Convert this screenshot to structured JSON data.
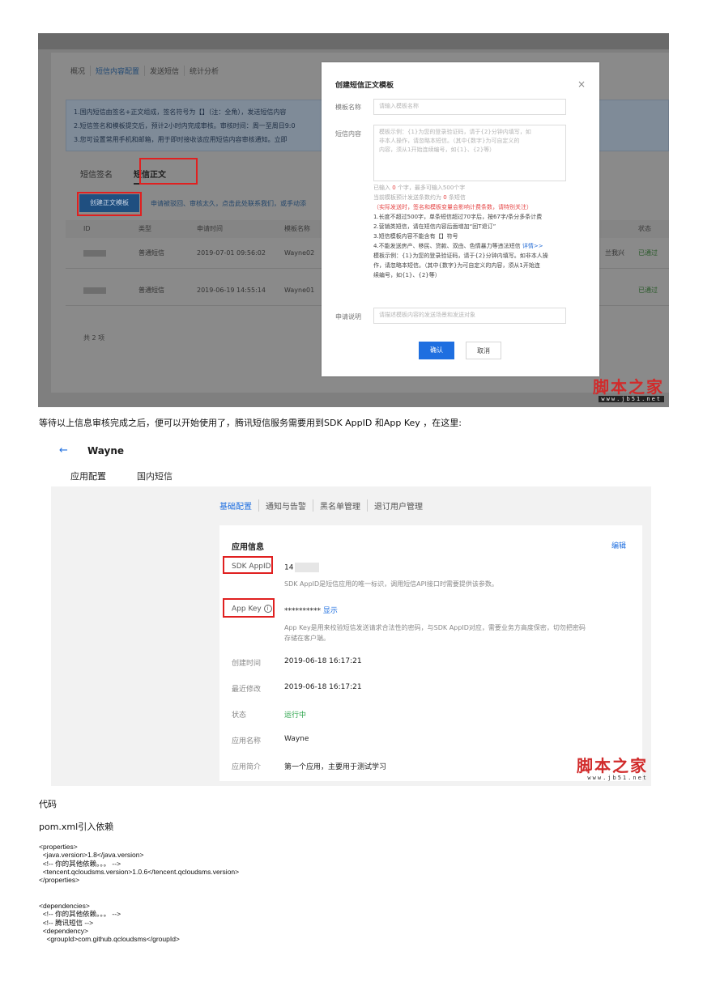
{
  "shot1": {
    "tabs": [
      "概况",
      "短信内容配置",
      "发送短信",
      "统计分析"
    ],
    "notice": [
      "1.国内短信由签名+正文组成，签名符号为【】（注：全角），发送短信内容",
      "2.短信签名和模板提交后，预计2小时内完成审核。审核时间：周一至周日9:0",
      "3.您可设置常用手机和邮箱，用于即时接收该应用短信内容审核通知。立即"
    ],
    "subtabs": [
      "短信签名",
      "短信正文"
    ],
    "create_button": "创建正文模板",
    "link_text": "申请被驳回、审核太久，点击此处联系我们，或手动添",
    "table_headers": [
      "ID",
      "类型",
      "申请时间",
      "模板名称",
      "状态"
    ],
    "rows": [
      {
        "type": "普通短信",
        "time": "2019-07-01 09:56:02",
        "name": "Wayne02",
        "extra": "兰我兴",
        "status": "已通过"
      },
      {
        "type": "普通短信",
        "time": "2019-06-19 14:55:14",
        "name": "Wayne01",
        "extra": "",
        "status": "已通过"
      }
    ],
    "total": "共 2 项"
  },
  "modal": {
    "title": "创建短信正文模板",
    "close": "×",
    "name_label": "模板名称",
    "name_placeholder": "请输入模板名称",
    "content_label": "短信内容",
    "content_placeholder": [
      "模板示例：{1}为您的登录验证码，请于{2}分钟内填写，如",
      "非本人操作，请忽略本短信。（其中{数字}为可自定义的",
      "内容，须从1开始连续编号，如{1}、{2}等）"
    ],
    "counter_prefix": "已输入",
    "counter_count": "0",
    "counter_suffix": "个字，最多可输入500个字",
    "estimate_prefix": "当前模板预计发送条数约为",
    "estimate_count": "0",
    "estimate_suffix": "条短信",
    "red_note": "（实际发送时，签名和模板变量会影响计费条数，请特别关注）",
    "rule1": "1.长度不超过500字，单条短信超过70字后，按67字/条分多条计费",
    "rule2": "2.营销类短信，请在短信内容后面增加“回T退订”",
    "rule3": "3.短信模板内容不能含有【】符号",
    "rule4": "4.不能发送房产、移民、贷款、双由、色情暴力等违法短信",
    "rule4_link": "详情>>",
    "example1": "模板示例：{1}为您的登录验证码，请于{2}分钟内填写。如非本人操",
    "example2": "作，请忽略本短信。（其中{数字}为可自定义的内容，须从1开始连",
    "example3": "续编号，如{1}、{2}等）",
    "reason_label": "申请说明",
    "reason_placeholder": "请描述模板内容的发送场景和发送对象",
    "ok": "确认",
    "cancel": "取消"
  },
  "watermark": {
    "main": "脚本之家",
    "sub": "www.jb51.net"
  },
  "paragraph1": "等待以上信息审核完成之后，便可以开始使用了，腾讯短信服务需要用到SDK AppID 和App Key ，在这里:",
  "shot2": {
    "back": "←",
    "app_name": "Wayne",
    "tabs": [
      "应用配置",
      "国内短信"
    ],
    "subnav": [
      "基础配置",
      "通知与告警",
      "黑名单管理",
      "退订用户管理"
    ],
    "card_title": "应用信息",
    "edit": "编辑",
    "sdk_label": "SDK AppID",
    "sdk_value": "14",
    "sdk_desc": "SDK AppID是短信应用的唯一标识，调用短信API接口时需要提供该参数。",
    "appkey_label": "App Key",
    "appkey_value": "**********",
    "appkey_show": "显示",
    "appkey_desc1": "App Key是用来校验短信发送请求合法性的密码，与SDK AppID对应，需要业务方高度保密，切勿把密码",
    "appkey_desc2": "存储在客户端。",
    "created_label": "创建时间",
    "created_value": "2019-06-18 16:17:21",
    "modified_label": "最近修改",
    "modified_value": "2019-06-18 16:17:21",
    "status_label": "状态",
    "status_value": "运行中",
    "appname_label": "应用名称",
    "appname_value": "Wayne",
    "intro_label": "应用简介",
    "intro_value": "第一个应用，主要用于测试学习"
  },
  "heading_code": "代码",
  "heading_pom": "pom.xml引入依赖",
  "code1": "<properties>\n  <java.version>1.8</java.version>\n  <!-- 你的其他依赖。。。 -->\n  <tencent.qcloudsms.version>1.0.6</tencent.qcloudsms.version>\n</properties>",
  "code2": "<dependencies>\n  <!-- 你的其他依赖。。。 -->\n  <!-- 腾讯短信 -->\n  <dependency>\n    <groupId>com.github.qcloudsms</groupId>",
  "colors": {
    "accent": "#1f6fe0",
    "highlight": "#e02020",
    "watermark": "#d12b2b",
    "ok_green": "#2aa34a"
  }
}
